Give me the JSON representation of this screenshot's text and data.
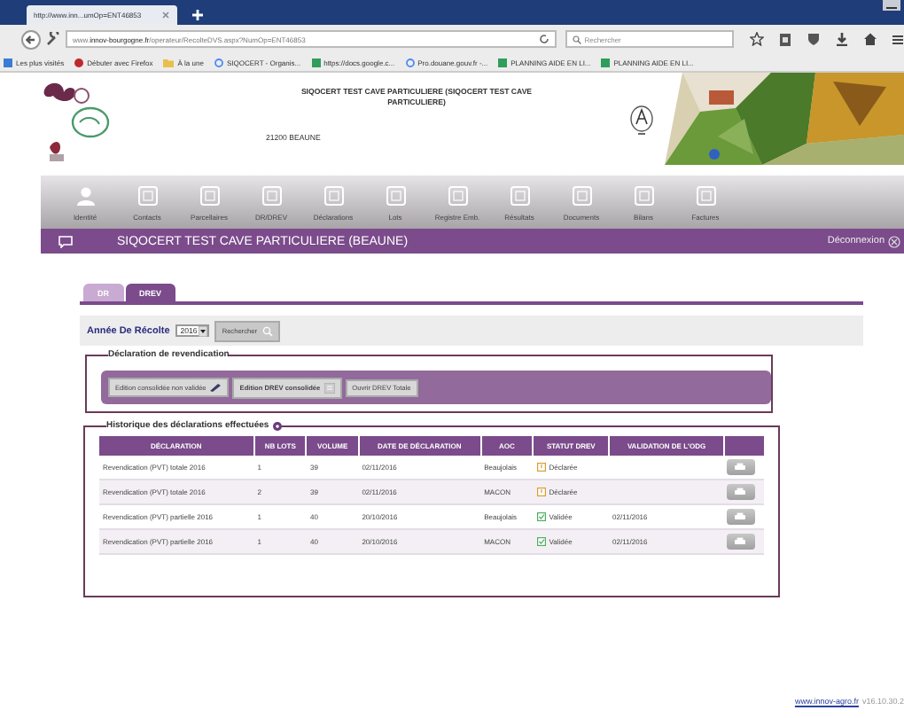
{
  "browser": {
    "tab_title": "http://www.inn...umOp=ENT46853",
    "url_prefix": "www.",
    "url_domain": "innov-bourgogne.fr",
    "url_path": "/operateur/RecolteDVS.aspx?NumOp=ENT46853",
    "search_placeholder": "Rechercher",
    "bookmarks": [
      {
        "label": "Les plus visités",
        "kind": "blue"
      },
      {
        "label": "Débuter avec Firefox",
        "kind": "red"
      },
      {
        "label": "À la une",
        "kind": "folder"
      },
      {
        "label": "SIQOCERT - Organis...",
        "kind": "google"
      },
      {
        "label": "https://docs.google.c...",
        "kind": "green"
      },
      {
        "label": "Pro.douane.gouv.fr -...",
        "kind": "google"
      },
      {
        "label": "PLANNING AIDE EN LI...",
        "kind": "green"
      },
      {
        "label": "PLANNING AIDE EN LI...",
        "kind": "green"
      }
    ]
  },
  "header": {
    "title": "SIQOCERT TEST CAVE PARTICULIERE (SIQOCERT TEST CAVE PARTICULIERE)",
    "address": "21200  BEAUNE"
  },
  "nav": [
    {
      "label": "Identité",
      "kind": "person"
    },
    {
      "label": "Contacts",
      "kind": "tile"
    },
    {
      "label": "Parcellaires",
      "kind": "tile"
    },
    {
      "label": "DR/DREV",
      "kind": "tile"
    },
    {
      "label": "Déclarations",
      "kind": "tile"
    },
    {
      "label": "Lots",
      "kind": "tile"
    },
    {
      "label": "Registre Emb.",
      "kind": "tile"
    },
    {
      "label": "Résultats",
      "kind": "tile"
    },
    {
      "label": "Documents",
      "kind": "tile"
    },
    {
      "label": "Bilans",
      "kind": "tile"
    },
    {
      "label": "Factures",
      "kind": "tile"
    }
  ],
  "banner": {
    "title": "SIQOCERT TEST CAVE PARTICULIERE (BEAUNE)",
    "logout": "Déconnexion"
  },
  "tabs": [
    {
      "label": "DR",
      "selected": false
    },
    {
      "label": "DREV",
      "selected": true
    }
  ],
  "filter": {
    "label": "Année De Récolte",
    "year": "2016",
    "button": "Rechercher"
  },
  "claim": {
    "legend": "Déclaration de revendication",
    "buttons": [
      {
        "label": "Edition consolidée non validée",
        "kind": "pen"
      },
      {
        "label": "Edition DREV consolidée",
        "kind": "menu"
      },
      {
        "label": "Ouvrir DREV Totale",
        "kind": "plain"
      }
    ]
  },
  "history": {
    "legend": "Historique des déclarations effectuées",
    "columns": [
      "DÉCLARATION",
      "NB LOTS",
      "VOLUME",
      "DATE DE DÉCLARATION",
      "AOC",
      "STATUT DREV",
      "VALIDATION DE L'ODG"
    ],
    "rows": [
      {
        "declaration": "Revendication (PVT) totale 2016",
        "lots": "1",
        "volume": "39",
        "date": "02/11/2016",
        "aoc": "Beaujolais",
        "status": "Déclarée",
        "kind": "declared"
      },
      {
        "declaration": "Revendication (PVT) totale 2016",
        "lots": "2",
        "volume": "39",
        "date": "02/11/2016",
        "aoc": "MACON",
        "status": "Déclarée",
        "kind": "declared"
      },
      {
        "declaration": "Revendication (PVT) partielle 2016",
        "lots": "1",
        "volume": "40",
        "date": "20/10/2016",
        "aoc": "Beaujolais",
        "status": "Validée",
        "kind": "validated",
        "validation": "02/11/2016"
      },
      {
        "declaration": "Revendication (PVT) partielle 2016",
        "lots": "1",
        "volume": "40",
        "date": "20/10/2016",
        "aoc": "MACON",
        "status": "Validée",
        "kind": "validated",
        "validation": "02/11/2016"
      }
    ]
  },
  "footer": {
    "link": "www.innov-agro.fr",
    "version": "v16.10.30.2"
  }
}
